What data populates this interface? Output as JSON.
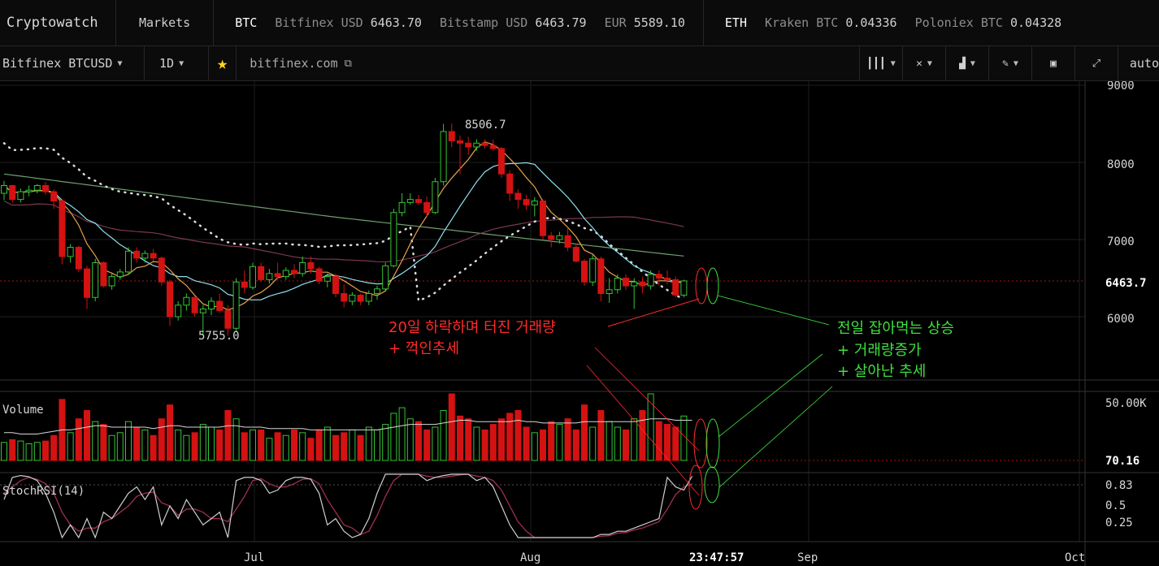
{
  "topbar": {
    "brand": "Cryptowatch",
    "markets": "Markets",
    "groups": [
      {
        "symbol": "BTC",
        "tickers": [
          {
            "label": "Bitfinex USD",
            "price": "6463.70"
          },
          {
            "label": "Bitstamp USD",
            "price": "6463.79"
          },
          {
            "label": "EUR",
            "price": "5589.10"
          }
        ]
      },
      {
        "symbol": "ETH",
        "tickers": [
          {
            "label": "Kraken BTC",
            "price": "0.04336"
          },
          {
            "label": "Poloniex BTC",
            "price": "0.04328"
          }
        ]
      }
    ]
  },
  "toolbar": {
    "market": "Bitfinex BTCUSD",
    "timeframe": "1D",
    "source": "bitfinex.com",
    "auto": "auto"
  },
  "annotations": {
    "red_line1": "20일 하락하며 터진 거래량",
    "red_line2": "+ 꺽인추세",
    "green_line1": "전일 잡아먹는 상승",
    "green_line2": "+ 거래량증가",
    "green_line3": "+ 살아난 추세"
  },
  "chart_data": {
    "type": "candlestick",
    "price_axis": {
      "ticks": [
        "9000",
        "8000",
        "7000",
        "6000"
      ],
      "range": [
        5600,
        9100
      ],
      "last_price": "6463.7"
    },
    "labels": {
      "high": "8506.7",
      "low": "5755.0"
    },
    "x_axis": {
      "ticks": [
        "Jul",
        "Aug",
        "Sep",
        "Oct"
      ],
      "crosshair_time": "23:47:57"
    },
    "candles": [
      [
        7600,
        7760,
        7510,
        7700
      ],
      [
        7700,
        7710,
        7480,
        7520
      ],
      [
        7520,
        7660,
        7480,
        7620
      ],
      [
        7620,
        7700,
        7560,
        7640
      ],
      [
        7640,
        7720,
        7600,
        7700
      ],
      [
        7700,
        7750,
        7580,
        7620
      ],
      [
        7620,
        7650,
        7400,
        7500
      ],
      [
        7500,
        7520,
        6680,
        6780
      ],
      [
        6780,
        6940,
        6700,
        6900
      ],
      [
        6900,
        6920,
        6580,
        6620
      ],
      [
        6620,
        6660,
        6100,
        6250
      ],
      [
        6250,
        6750,
        6200,
        6700
      ],
      [
        6700,
        6720,
        6380,
        6400
      ],
      [
        6400,
        6560,
        6350,
        6520
      ],
      [
        6520,
        6620,
        6480,
        6580
      ],
      [
        6580,
        6900,
        6550,
        6850
      ],
      [
        6850,
        6900,
        6700,
        6760
      ],
      [
        6760,
        6860,
        6700,
        6820
      ],
      [
        6820,
        6880,
        6720,
        6760
      ],
      [
        6760,
        6780,
        6400,
        6450
      ],
      [
        6450,
        6480,
        5880,
        6000
      ],
      [
        6000,
        6200,
        5950,
        6150
      ],
      [
        6150,
        6300,
        6080,
        6250
      ],
      [
        6250,
        6260,
        6000,
        6050
      ],
      [
        6050,
        6150,
        5760,
        6100
      ],
      [
        6100,
        6250,
        6020,
        6200
      ],
      [
        6200,
        6300,
        6050,
        6080
      ],
      [
        6080,
        6150,
        5755,
        5850
      ],
      [
        5850,
        6500,
        5800,
        6450
      ],
      [
        6450,
        6600,
        6300,
        6380
      ],
      [
        6380,
        6700,
        6350,
        6650
      ],
      [
        6650,
        6700,
        6450,
        6480
      ],
      [
        6480,
        6620,
        6430,
        6560
      ],
      [
        6560,
        6700,
        6480,
        6520
      ],
      [
        6520,
        6640,
        6480,
        6600
      ],
      [
        6600,
        6680,
        6500,
        6560
      ],
      [
        6560,
        6780,
        6520,
        6700
      ],
      [
        6700,
        6780,
        6560,
        6620
      ],
      [
        6620,
        6650,
        6420,
        6460
      ],
      [
        6460,
        6560,
        6380,
        6520
      ],
      [
        6520,
        6560,
        6250,
        6300
      ],
      [
        6300,
        6420,
        6120,
        6200
      ],
      [
        6200,
        6320,
        6150,
        6280
      ],
      [
        6280,
        6300,
        6150,
        6200
      ],
      [
        6200,
        6340,
        6150,
        6300
      ],
      [
        6300,
        6400,
        6220,
        6360
      ],
      [
        6360,
        6700,
        6340,
        6660
      ],
      [
        6660,
        7400,
        6640,
        7350
      ],
      [
        7350,
        7600,
        7300,
        7480
      ],
      [
        7480,
        7600,
        7450,
        7520
      ],
      [
        7520,
        7580,
        7450,
        7480
      ],
      [
        7480,
        7560,
        7300,
        7350
      ],
      [
        7350,
        7800,
        7330,
        7750
      ],
      [
        7750,
        8500,
        7700,
        8400
      ],
      [
        8400,
        8507,
        8200,
        8280
      ],
      [
        8280,
        8350,
        7850,
        8250
      ],
      [
        8250,
        8330,
        8100,
        8200
      ],
      [
        8200,
        8300,
        8150,
        8250
      ],
      [
        8250,
        8300,
        8180,
        8220
      ],
      [
        8220,
        8300,
        8150,
        8180
      ],
      [
        8180,
        8200,
        7800,
        7850
      ],
      [
        7850,
        7900,
        7500,
        7600
      ],
      [
        7600,
        7650,
        7400,
        7520
      ],
      [
        7520,
        7580,
        7380,
        7450
      ],
      [
        7450,
        7550,
        7300,
        7500
      ],
      [
        7500,
        7520,
        7000,
        7050
      ],
      [
        7050,
        7100,
        6900,
        7000
      ],
      [
        7000,
        7100,
        6950,
        7050
      ],
      [
        7050,
        7150,
        6850,
        6900
      ],
      [
        6900,
        6950,
        6700,
        6720
      ],
      [
        6720,
        6750,
        6400,
        6450
      ],
      [
        6450,
        6800,
        6400,
        6750
      ],
      [
        6750,
        6780,
        6200,
        6300
      ],
      [
        6300,
        6500,
        6180,
        6350
      ],
      [
        6350,
        6550,
        6300,
        6500
      ],
      [
        6500,
        6550,
        6350,
        6400
      ],
      [
        6400,
        6500,
        6100,
        6450
      ],
      [
        6450,
        6520,
        6300,
        6400
      ],
      [
        6400,
        6600,
        6350,
        6550
      ],
      [
        6550,
        6600,
        6400,
        6500
      ],
      [
        6500,
        6600,
        6420,
        6480
      ],
      [
        6480,
        6520,
        6250,
        6280
      ],
      [
        6280,
        6480,
        6250,
        6463.7
      ]
    ],
    "volume": {
      "label": "Volume",
      "ticks": [
        "50.00K",
        "70.16"
      ],
      "values": [
        13,
        15,
        14,
        12,
        13,
        14,
        18,
        44,
        20,
        30,
        36,
        28,
        26,
        18,
        20,
        28,
        24,
        22,
        18,
        30,
        40,
        22,
        18,
        20,
        26,
        24,
        22,
        36,
        30,
        20,
        22,
        22,
        16,
        20,
        18,
        22,
        20,
        16,
        22,
        24,
        18,
        20,
        22,
        18,
        24,
        22,
        26,
        34,
        38,
        30,
        28,
        22,
        24,
        36,
        48,
        32,
        30,
        24,
        22,
        26,
        30,
        34,
        36,
        24,
        20,
        22,
        28,
        26,
        30,
        22,
        40,
        24,
        36,
        28,
        24,
        22,
        30,
        36,
        48,
        28,
        26,
        24,
        32,
        28
      ],
      "ma": [
        20,
        20,
        19,
        19,
        19,
        20,
        21,
        22,
        22,
        23,
        24,
        25,
        25,
        24,
        24,
        24,
        24,
        24,
        23,
        24,
        25,
        25,
        24,
        24,
        24,
        24,
        24,
        25,
        25,
        24,
        24,
        24,
        23,
        23,
        23,
        23,
        23,
        22,
        22,
        22,
        22,
        22,
        22,
        22,
        22,
        22,
        23,
        24,
        25,
        26,
        26,
        26,
        26,
        27,
        28,
        29,
        29,
        28,
        28,
        28,
        28,
        28,
        29,
        28,
        28,
        27,
        27,
        27,
        27,
        27,
        28,
        28,
        28,
        28,
        28,
        28,
        28,
        29,
        30,
        30,
        30,
        29,
        29,
        29
      ]
    },
    "stochrsi": {
      "label": "StochRSI(14)",
      "ticks": [
        "0.83",
        "0.5",
        "0.25"
      ],
      "k": [
        0.6,
        0.95,
        0.98,
        0.96,
        0.9,
        0.7,
        0.4,
        0.0,
        0.2,
        0.0,
        0.3,
        0.0,
        0.4,
        0.3,
        0.5,
        0.7,
        0.8,
        0.6,
        0.8,
        0.2,
        0.5,
        0.3,
        0.6,
        0.4,
        0.2,
        0.3,
        0.4,
        0.0,
        0.9,
        0.95,
        0.95,
        0.9,
        0.7,
        0.75,
        0.9,
        0.95,
        0.95,
        0.92,
        0.7,
        0.2,
        0.3,
        0.1,
        0.0,
        0.05,
        0.3,
        0.7,
        1.0,
        1.0,
        1.0,
        1.0,
        1.0,
        0.9,
        0.95,
        0.98,
        1.0,
        1.0,
        1.0,
        0.9,
        0.95,
        0.8,
        0.5,
        0.2,
        0.0,
        0.0,
        0.0,
        0.0,
        0.0,
        0.0,
        0.0,
        0.0,
        0.0,
        0.0,
        0.05,
        0.05,
        0.1,
        0.1,
        0.15,
        0.2,
        0.25,
        0.3,
        0.95,
        0.8,
        0.75,
        0.97
      ],
      "d": [
        0.7,
        0.8,
        0.9,
        0.95,
        0.92,
        0.85,
        0.7,
        0.4,
        0.2,
        0.1,
        0.15,
        0.15,
        0.25,
        0.3,
        0.4,
        0.5,
        0.65,
        0.7,
        0.72,
        0.55,
        0.5,
        0.35,
        0.45,
        0.45,
        0.4,
        0.3,
        0.3,
        0.25,
        0.45,
        0.65,
        0.9,
        0.93,
        0.85,
        0.8,
        0.8,
        0.85,
        0.92,
        0.93,
        0.85,
        0.6,
        0.4,
        0.2,
        0.15,
        0.05,
        0.1,
        0.35,
        0.65,
        0.9,
        1.0,
        1.0,
        1.0,
        0.97,
        0.95,
        0.95,
        0.97,
        0.99,
        1.0,
        0.97,
        0.95,
        0.9,
        0.75,
        0.5,
        0.25,
        0.1,
        0.0,
        0.0,
        0.0,
        0.0,
        0.0,
        0.0,
        0.0,
        0.0,
        0.02,
        0.03,
        0.07,
        0.08,
        0.12,
        0.15,
        0.2,
        0.25,
        0.45,
        0.68,
        0.8,
        0.85
      ]
    }
  }
}
